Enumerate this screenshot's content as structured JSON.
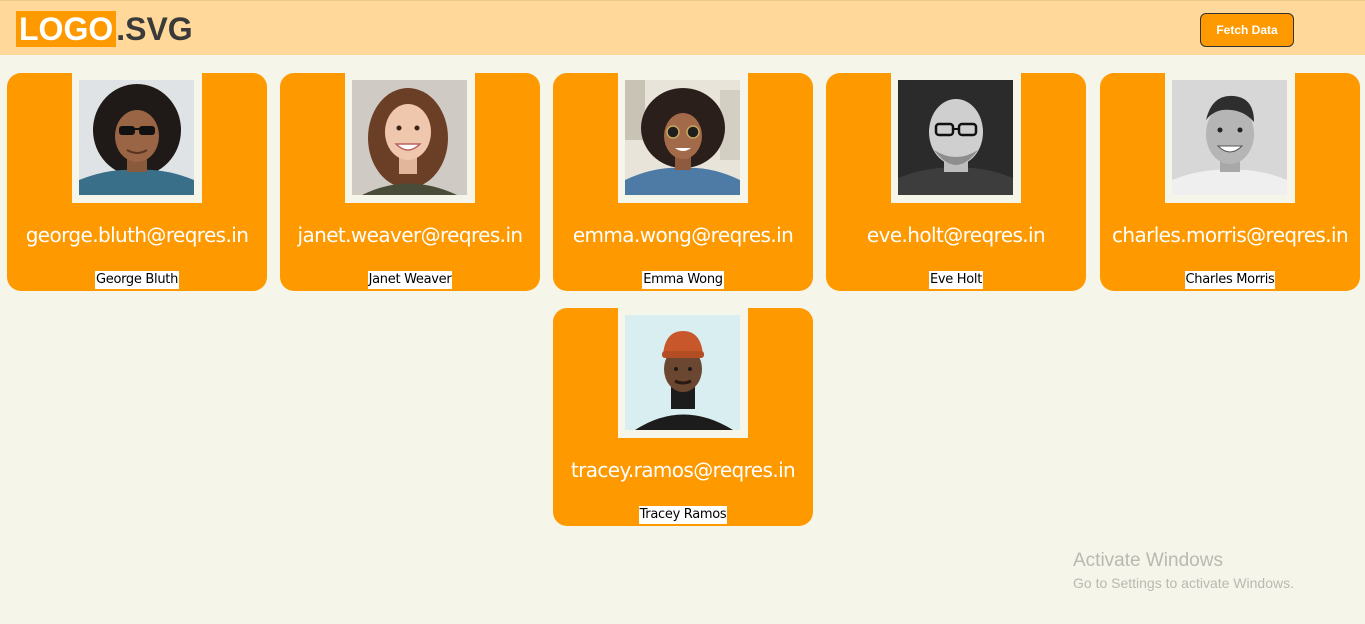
{
  "navbar": {
    "logo_main": "LOGO",
    "logo_ext": ".SVG",
    "fetch_label": "Fetch Data"
  },
  "users": [
    {
      "email": "george.bluth@reqres.in",
      "name": "George Bluth"
    },
    {
      "email": "janet.weaver@reqres.in",
      "name": "Janet Weaver"
    },
    {
      "email": "emma.wong@reqres.in",
      "name": "Emma Wong"
    },
    {
      "email": "eve.holt@reqres.in",
      "name": "Eve Holt"
    },
    {
      "email": "charles.morris@reqres.in",
      "name": "Charles Morris"
    },
    {
      "email": "tracey.ramos@reqres.in",
      "name": "Tracey Ramos"
    }
  ],
  "watermark": {
    "title": "Activate Windows",
    "subtitle": "Go to Settings to activate Windows."
  },
  "colors": {
    "accent": "#ff9900",
    "navbar": "#ffd89a",
    "background": "#f6f5e9"
  }
}
